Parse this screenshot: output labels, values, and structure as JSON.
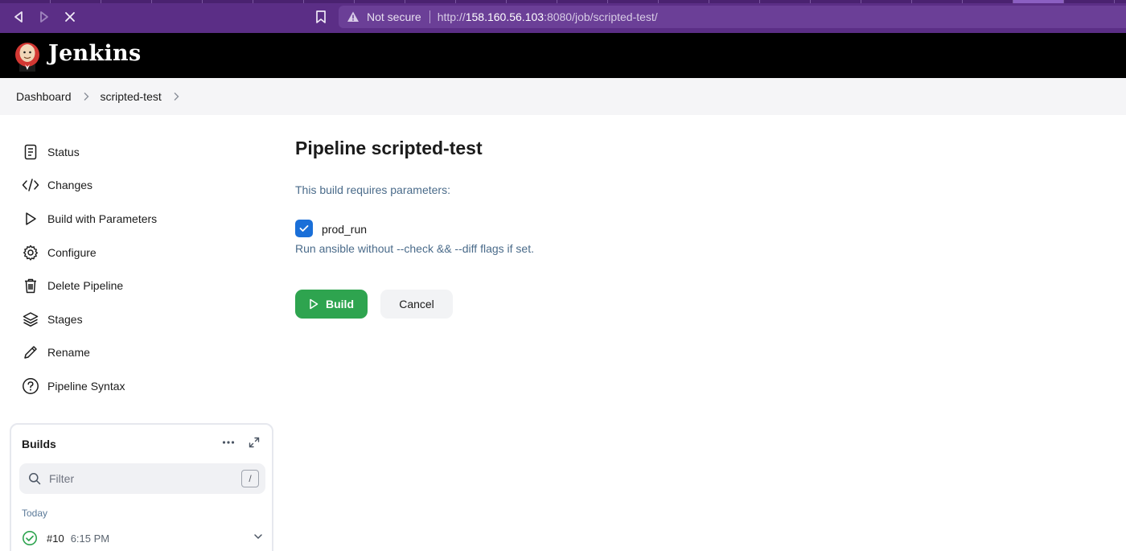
{
  "browser": {
    "not_secure_label": "Not secure",
    "url_host": "158.160.56.103",
    "url_prefix": "http://",
    "url_suffix": ":8080/job/scripted-test/"
  },
  "header": {
    "app_name": "Jenkins"
  },
  "breadcrumb": {
    "items": [
      "Dashboard",
      "scripted-test"
    ]
  },
  "sidebar": {
    "items": [
      {
        "label": "Status",
        "icon": "document-icon"
      },
      {
        "label": "Changes",
        "icon": "code-icon"
      },
      {
        "label": "Build with Parameters",
        "icon": "play-icon"
      },
      {
        "label": "Configure",
        "icon": "gear-icon"
      },
      {
        "label": "Delete Pipeline",
        "icon": "trash-icon"
      },
      {
        "label": "Stages",
        "icon": "layers-icon"
      },
      {
        "label": "Rename",
        "icon": "pencil-icon"
      },
      {
        "label": "Pipeline Syntax",
        "icon": "help-icon"
      }
    ]
  },
  "builds": {
    "title": "Builds",
    "filter_placeholder": "Filter",
    "shortcut_key": "/",
    "group_label": "Today",
    "entries": [
      {
        "number": "#10",
        "time": "6:15 PM",
        "status": "success"
      }
    ]
  },
  "main": {
    "title": "Pipeline scripted-test",
    "requires_text": "This build requires parameters:",
    "parameter": {
      "name": "prod_run",
      "checked": true,
      "description": "Run ansible without --check && --diff flags if set."
    },
    "build_label": "Build",
    "cancel_label": "Cancel"
  },
  "colors": {
    "browser_bar": "#5b2e86",
    "header_bg": "#000000",
    "build_button": "#2ea44f",
    "checkbox": "#1a6fd8",
    "success": "#2ea44f"
  }
}
